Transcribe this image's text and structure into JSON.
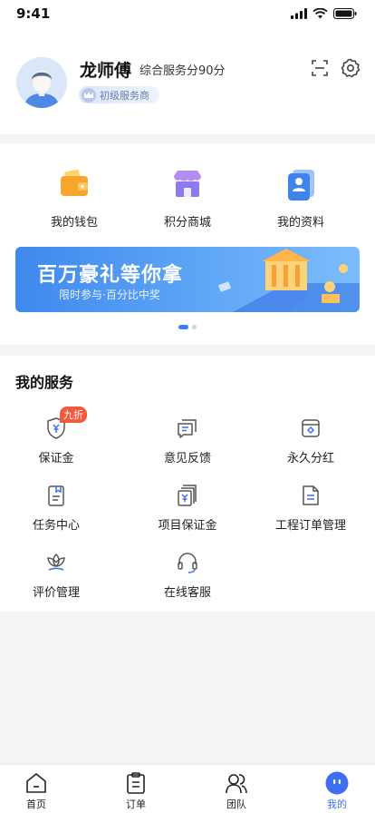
{
  "status_bar": {
    "time": "9:41"
  },
  "profile": {
    "name": "龙师傅",
    "score_label": "综合服务分90分",
    "level": "初级服务商"
  },
  "quick_actions": [
    {
      "label": "我的钱包",
      "icon": "wallet-icon"
    },
    {
      "label": "积分商城",
      "icon": "store-icon"
    },
    {
      "label": "我的资料",
      "icon": "profile-card-icon"
    }
  ],
  "banner": {
    "title": "百万豪礼等你拿",
    "subtitle": "限时参与·百分比中奖",
    "page_count": 2,
    "active_page": 1
  },
  "services": {
    "title": "我的服务",
    "items": [
      {
        "label": "保证金",
        "icon": "shield-yen-icon",
        "badge": "九折"
      },
      {
        "label": "意见反馈",
        "icon": "feedback-icon"
      },
      {
        "label": "永久分红",
        "icon": "dividend-box-icon"
      },
      {
        "label": "任务中心",
        "icon": "task-doc-icon"
      },
      {
        "label": "项目保证金",
        "icon": "project-deposit-icon"
      },
      {
        "label": "工程订单管理",
        "icon": "order-doc-icon"
      },
      {
        "label": "评价管理",
        "icon": "rating-lotus-icon"
      },
      {
        "label": "在线客服",
        "icon": "headset-icon"
      }
    ]
  },
  "tabbar": {
    "items": [
      {
        "label": "首页",
        "icon": "home-icon"
      },
      {
        "label": "订单",
        "icon": "order-clipboard-icon"
      },
      {
        "label": "团队",
        "icon": "team-icon"
      },
      {
        "label": "我的",
        "icon": "mine-face-icon",
        "active": true
      }
    ]
  },
  "colors": {
    "accent": "#3d6ff0",
    "badge_red": "#f25a3c",
    "banner_start": "#3f89ee",
    "banner_end": "#7bbcfa",
    "icon_gray": "#555555"
  }
}
